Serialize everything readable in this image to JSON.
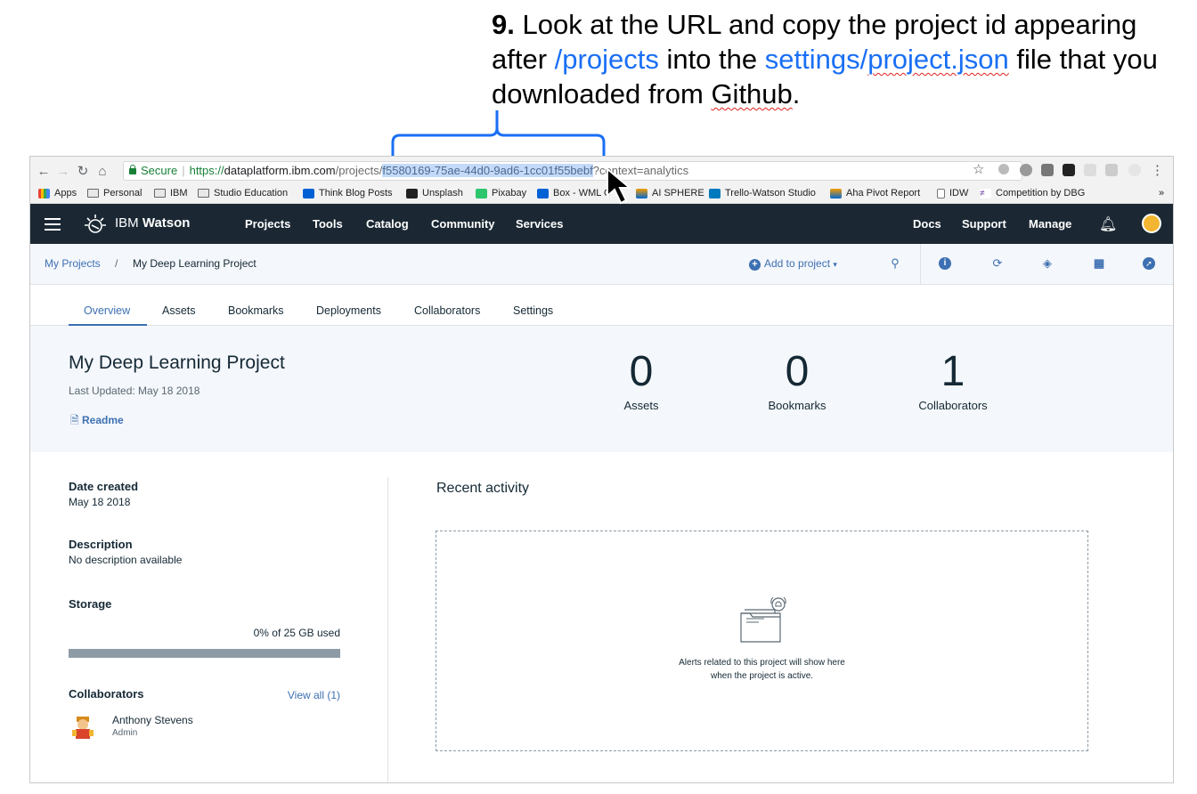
{
  "instruction": {
    "step": "9.",
    "t1": " Look at the URL and copy the project id appearing after ",
    "link1": "/projects",
    "t2": " into the ",
    "link2_a": "settings/",
    "link2_b": "project.json",
    "t3": " file that you downloaded from ",
    "t4": "Github",
    "t5": "."
  },
  "browser": {
    "secure_label": "Secure",
    "url": {
      "scheme": "https://",
      "host": "dataplatform.ibm.com",
      "path_prefix": "/projects/",
      "project_id": "f5580169-75ae-44d0-9ad6-1cc01f55bebf",
      "query": "?context=analytics"
    },
    "bookmarks": [
      {
        "label": "Apps",
        "icon": "apps-grid-icon"
      },
      {
        "label": "Personal",
        "icon": "folder-icon"
      },
      {
        "label": "IBM",
        "icon": "folder-icon"
      },
      {
        "label": "Studio Education",
        "icon": "folder-icon"
      },
      {
        "label": "Think Blog Posts",
        "icon": "box-icon"
      },
      {
        "label": "Unsplash",
        "icon": "camera-icon"
      },
      {
        "label": "Pixabay",
        "icon": "pixabay-icon"
      },
      {
        "label": "Box - WML O",
        "icon": "box-icon"
      },
      {
        "label": "AI SPHERE",
        "icon": "aha-icon"
      },
      {
        "label": "Trello-Watson Studio",
        "icon": "trello-icon"
      },
      {
        "label": "Aha Pivot Report",
        "icon": "aha-icon"
      },
      {
        "label": "IDW",
        "icon": "page-icon"
      },
      {
        "label": "Competition by DBG",
        "icon": "dbg-icon"
      }
    ],
    "more": "»"
  },
  "header": {
    "brand_a": "IBM",
    "brand_b": "Watson",
    "nav": [
      "Projects",
      "Tools",
      "Catalog",
      "Community",
      "Services"
    ],
    "right": [
      "Docs",
      "Support",
      "Manage"
    ]
  },
  "breadcrumb": {
    "root": "My Projects",
    "sep": "/",
    "current": "My Deep Learning Project",
    "add": "Add to project"
  },
  "tabs": [
    "Overview",
    "Assets",
    "Bookmarks",
    "Deployments",
    "Collaborators",
    "Settings"
  ],
  "project": {
    "title": "My Deep Learning Project",
    "updated": "Last Updated: May 18 2018",
    "readme": "Readme",
    "stats": [
      {
        "value": "0",
        "label": "Assets"
      },
      {
        "value": "0",
        "label": "Bookmarks"
      },
      {
        "value": "1",
        "label": "Collaborators"
      }
    ]
  },
  "details": {
    "date_h": "Date created",
    "date_v": "May 18 2018",
    "desc_h": "Description",
    "desc_v": "No description available",
    "storage_h": "Storage",
    "storage_v": "0% of 25 GB used",
    "storage_used_fraction": 0,
    "collab_h": "Collaborators",
    "view_all": "View all (1)",
    "collab_name": "Anthony Stevens",
    "collab_role": "Admin"
  },
  "activity": {
    "title": "Recent activity",
    "empty_line1": "Alerts related to this project will show here",
    "empty_line2": "when the project is active."
  },
  "colors": {
    "nav_bg": "#1b2834",
    "accent": "#3d70b2",
    "instruction_link": "#1a6ff5",
    "bracket": "#1a6ff5"
  }
}
